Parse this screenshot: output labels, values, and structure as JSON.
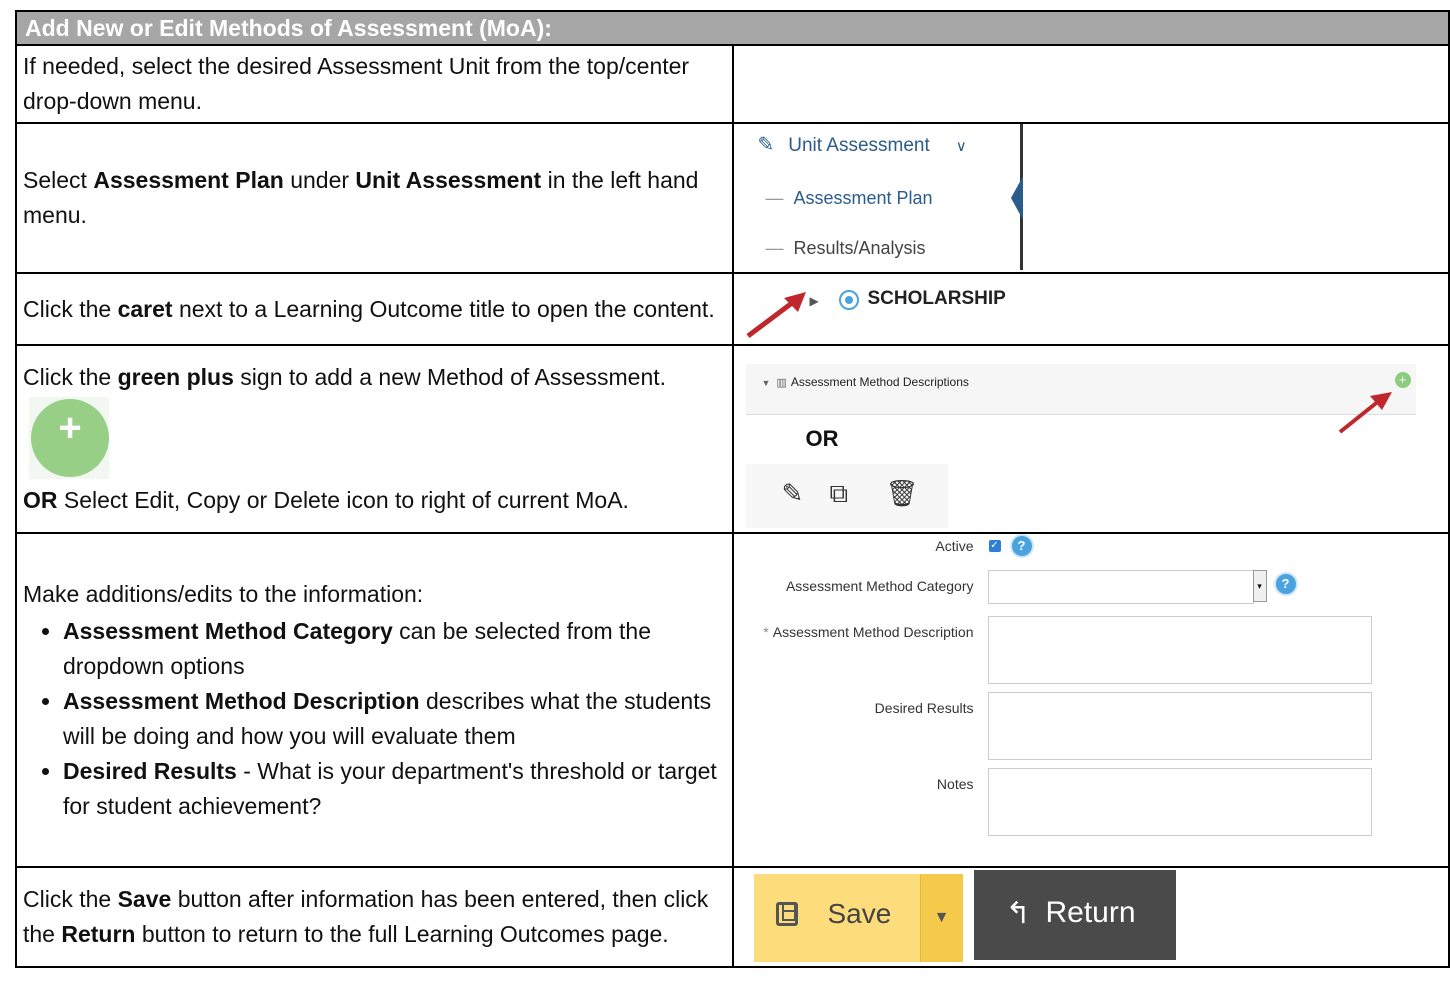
{
  "header": "Add New or Edit Methods of Assessment (MoA):",
  "rows": {
    "r1": {
      "text": "If needed, select the desired Assessment Unit from the top/center drop-down menu."
    },
    "r2": {
      "t1": "Select ",
      "b1": "Assessment Plan",
      "t2": " under ",
      "b2": "Unit Assessment",
      "t3": " in the left hand menu."
    },
    "r3": {
      "t1": "Click the ",
      "b1": "caret",
      "t2": " next to a Learning Outcome title to open the content."
    },
    "r4": {
      "t1": "Click the ",
      "b1": "green plus",
      "t2": " sign to add a new Method of Assessment.",
      "b2": "OR",
      "t3": " Select Edit, Copy or Delete icon to right of current MoA."
    },
    "r5": {
      "intro": "Make additions/edits to the information:",
      "bullets": [
        {
          "b": "Assessment Method Category",
          "t": " can be selected from the dropdown options"
        },
        {
          "b": "Assessment Method Description",
          "t": " describes what the students will be doing and how you will evaluate them"
        },
        {
          "b": "Desired Results",
          "t": " - What is your department's threshold or target for student achievement?"
        }
      ]
    },
    "r6": {
      "t1": "Click the ",
      "b1": "Save",
      "t2": " button after information has been entered, then click the ",
      "b2": "Return",
      "t3": " button to return to the full Learning Outcomes page."
    }
  },
  "screens": {
    "menu": {
      "title": "Unit Assessment",
      "items": [
        "Assessment Plan",
        "Results/Analysis"
      ]
    },
    "outcome": {
      "title": "SCHOLARSHIP"
    },
    "methods": {
      "title": "Assessment Method Descriptions",
      "or": "OR"
    },
    "form": {
      "active": "Active",
      "category": "Assessment Method Category",
      "description": "Assessment Method Description",
      "required_mark": "*",
      "desired": "Desired Results",
      "notes": "Notes",
      "help": "?"
    },
    "buttons": {
      "save": "Save",
      "return": "Return"
    }
  },
  "icons": [
    "pencil-icon",
    "chevron-down-icon",
    "caret-right-icon",
    "target-icon",
    "red-arrow-icon",
    "bar-chart-icon",
    "plus-icon",
    "edit-icon",
    "copy-icon",
    "trash-icon",
    "help-icon",
    "save-icon",
    "return-icon"
  ],
  "colors": {
    "header_bg": "#a6a6a6",
    "plus_green": "#97cf87",
    "save_yellow": "#fcdc7b",
    "return_dark": "#4a4a4a",
    "link_blue": "#2b5c8a",
    "arrow_red": "#c0272d"
  }
}
